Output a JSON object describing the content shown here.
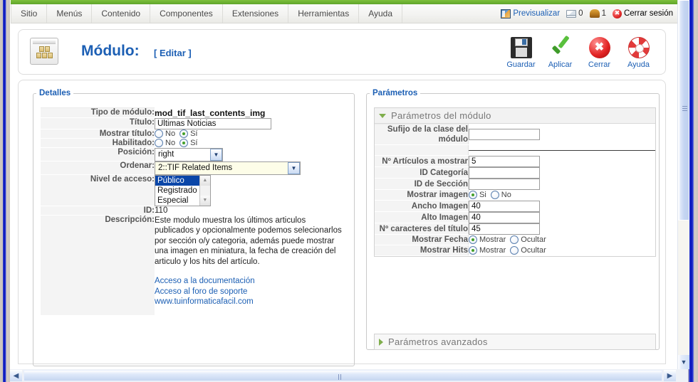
{
  "menubar": {
    "items": [
      {
        "label": "Sitio"
      },
      {
        "label": "Menús"
      },
      {
        "label": "Contenido"
      },
      {
        "label": "Componentes"
      },
      {
        "label": "Extensiones"
      },
      {
        "label": "Herramientas"
      },
      {
        "label": "Ayuda"
      }
    ]
  },
  "topright": {
    "preview_label": "Previsualizar",
    "preview_icon": "preview-icon",
    "messages_icon": "mail-icon",
    "messages_count": "0",
    "users_icon": "users-icon",
    "users_count": "1",
    "logout_icon": "logout-icon",
    "logout_label": "Cerrar sesión"
  },
  "page_header": {
    "icon": "module-boxes-icon",
    "title": "Módulo:",
    "subtitle": "[ Editar ]"
  },
  "toolbar": {
    "buttons": [
      {
        "label": "Guardar",
        "icon": "save-icon"
      },
      {
        "label": "Aplicar",
        "icon": "check-icon"
      },
      {
        "label": "Cerrar",
        "icon": "close-icon"
      },
      {
        "label": "Ayuda",
        "icon": "lifering-icon"
      }
    ]
  },
  "details": {
    "legend": "Detalles",
    "module_type": {
      "label": "Tipo de módulo:",
      "value": "mod_tif_last_contents_img"
    },
    "title": {
      "label": "Título:",
      "value": "Últimas Noticias"
    },
    "show_title": {
      "label": "Mostrar título:",
      "options": [
        {
          "label": "No",
          "selected": false
        },
        {
          "label": "Sí",
          "selected": true
        }
      ]
    },
    "enabled": {
      "label": "Habilitado:",
      "options": [
        {
          "label": "No",
          "selected": false
        },
        {
          "label": "Sí",
          "selected": true
        }
      ]
    },
    "position": {
      "label": "Posición:",
      "value": "right"
    },
    "order": {
      "label": "Ordenar:",
      "value": "2::TIF Related Items"
    },
    "access_level": {
      "label": "Nivel de acceso:",
      "options": [
        {
          "label": "Público",
          "selected": true
        },
        {
          "label": "Registrado",
          "selected": false
        },
        {
          "label": "Especial",
          "selected": false
        }
      ]
    },
    "id": {
      "label": "ID:",
      "value": "110"
    },
    "description": {
      "label": "Descripción:",
      "text": "Este modulo muestra los últimos articulos publicados y opcionalmente podemos selecionarlos por sección o/y categoria, además puede mostrar una imagen en miniatura, la fecha de creación del articulo y los hits del artículo.",
      "links": [
        "Acceso a la documentación",
        "Acceso al foro de soporte",
        "www.tuinformaticafacil.com"
      ]
    }
  },
  "parameters": {
    "legend": "Parámetros",
    "module_section": {
      "title": "Parámetros del módulo",
      "expanded": true,
      "rows": [
        {
          "label": "Sufijo de la clase del módulo",
          "type": "text",
          "value": ""
        },
        {
          "label": "",
          "type": "separator"
        },
        {
          "label": "Nº Artículos a mostrar",
          "type": "text",
          "value": "5"
        },
        {
          "label": "ID Categoría",
          "type": "text",
          "value": ""
        },
        {
          "label": "ID de Sección",
          "type": "text",
          "value": ""
        },
        {
          "label": "Mostrar imagen",
          "type": "radio",
          "options": [
            {
              "label": "Si",
              "selected": true
            },
            {
              "label": "No",
              "selected": false
            }
          ]
        },
        {
          "label": "Ancho Imagen",
          "type": "text",
          "value": "40"
        },
        {
          "label": "Alto Imagen",
          "type": "text",
          "value": "40"
        },
        {
          "label": "Nº caracteres del título",
          "type": "text",
          "value": "45"
        },
        {
          "label": "Mostrar Fecha",
          "type": "radio",
          "options": [
            {
              "label": "Mostrar",
              "selected": true
            },
            {
              "label": "Ocultar",
              "selected": false
            }
          ]
        },
        {
          "label": "Mostrar Hits",
          "type": "radio",
          "options": [
            {
              "label": "Mostrar",
              "selected": true
            },
            {
              "label": "Ocultar",
              "selected": false
            }
          ]
        }
      ]
    },
    "advanced_section": {
      "title": "Parámetros avanzados",
      "expanded": false
    }
  },
  "scrollbars": {
    "vertical_arrow_down": "chevron-down-icon",
    "horizontal_arrow_left": "chevron-left-icon",
    "horizontal_arrow_right": "chevron-right-icon"
  },
  "colors": {
    "accent_green": "#6cb22e",
    "link_blue": "#1c5fb4",
    "label_gray": "#555555",
    "select_blue": "#0a46a8"
  }
}
